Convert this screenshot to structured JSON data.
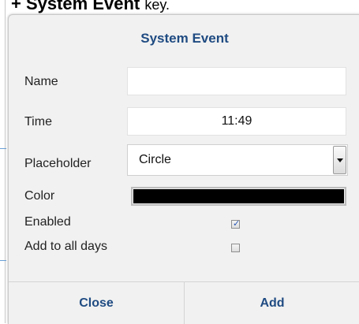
{
  "background": {
    "title": "+ System Event",
    "title_suffix": "key."
  },
  "dialog": {
    "title": "System Event",
    "name": {
      "label": "Name",
      "value": "",
      "placeholder": ""
    },
    "time": {
      "label": "Time",
      "value": "11:49"
    },
    "placeholder": {
      "label": "Placeholder",
      "selected": "Circle"
    },
    "color": {
      "label": "Color",
      "value": "#000000"
    },
    "enabled": {
      "label": "Enabled",
      "checked": true
    },
    "add_to_all_days": {
      "label": "Add to all days",
      "checked": false
    },
    "buttons": {
      "close": "Close",
      "add": "Add"
    }
  },
  "colors": {
    "accent": "#1f4b82",
    "dialog_bg": "#f1f1f1",
    "check": "#2a57b5"
  }
}
